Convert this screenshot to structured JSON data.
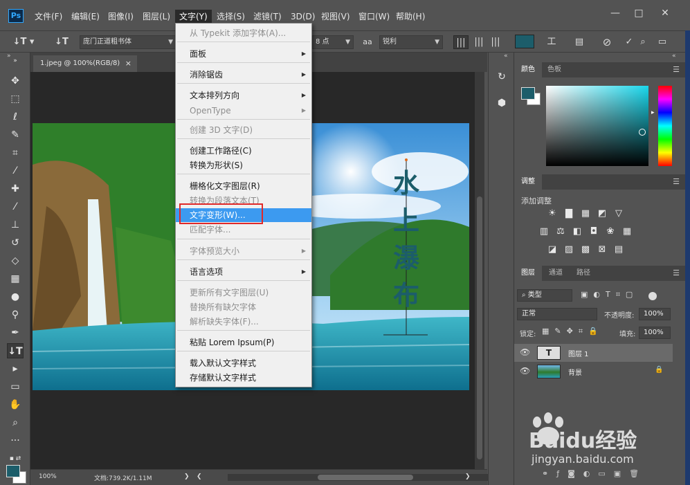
{
  "menubar": {
    "items": [
      "文件(F)",
      "编辑(E)",
      "图像(I)",
      "图层(L)",
      "文字(Y)",
      "选择(S)",
      "滤镜(T)",
      "3D(D)",
      "视图(V)",
      "窗口(W)",
      "帮助(H)"
    ],
    "active_index": 4,
    "window_buttons": [
      "—",
      "□",
      "✕"
    ]
  },
  "options_bar": {
    "font_family": "庞门正道粗书体",
    "font_size": "8 点",
    "antialias_label": "aa",
    "antialias_value": "锐利",
    "text_color": "#1c5d6a"
  },
  "document": {
    "tab_title": "1.jpeg @ 100%(RGB/8)",
    "tab_close": "×",
    "vertical_text": [
      "水",
      "上",
      "瀑",
      "布"
    ],
    "zoom": "100%",
    "doc_info": "文档:739.2K/1.11M"
  },
  "text_menu": {
    "items": [
      {
        "label": "从 Typekit 添加字体(A)...",
        "disabled": true,
        "submenu": false
      },
      {
        "label": "面板",
        "disabled": false,
        "submenu": true
      },
      {
        "label": "消除锯齿",
        "disabled": false,
        "submenu": true
      },
      {
        "label": "文本排列方向",
        "disabled": false,
        "submenu": true
      },
      {
        "label": "OpenType",
        "disabled": true,
        "submenu": true
      },
      {
        "label": "创建 3D 文字(D)",
        "disabled": true,
        "submenu": false
      },
      {
        "label": "创建工作路径(C)",
        "disabled": false,
        "submenu": false
      },
      {
        "label": "转换为形状(S)",
        "disabled": false,
        "submenu": false
      },
      {
        "label": "栅格化文字图层(R)",
        "disabled": false,
        "submenu": false
      },
      {
        "label": "转换为段落文本(T)",
        "disabled": true,
        "submenu": false
      },
      {
        "label": "文字变形(W)...",
        "disabled": false,
        "submenu": false,
        "highlighted": true
      },
      {
        "label": "匹配字体...",
        "disabled": true,
        "submenu": false
      },
      {
        "label": "字体预览大小",
        "disabled": true,
        "submenu": true
      },
      {
        "label": "语言选项",
        "disabled": false,
        "submenu": true
      },
      {
        "label": "更新所有文字图层(U)",
        "disabled": true,
        "submenu": false
      },
      {
        "label": "替换所有缺欠字体",
        "disabled": true,
        "submenu": false
      },
      {
        "label": "解析缺失字体(F)...",
        "disabled": true,
        "submenu": false
      },
      {
        "label": "粘贴 Lorem Ipsum(P)",
        "disabled": false,
        "submenu": false
      },
      {
        "label": "载入默认文字样式",
        "disabled": false,
        "submenu": false
      },
      {
        "label": "存储默认文字样式",
        "disabled": false,
        "submenu": false
      }
    ]
  },
  "panels": {
    "color_tabs": [
      "颜色",
      "色板"
    ],
    "adjust_tab": "调整",
    "adjust_label": "添加调整",
    "layers_tabs": [
      "图层",
      "通道",
      "路径"
    ],
    "filter_kind": "类型",
    "blend_mode": "正常",
    "opacity_label": "不透明度:",
    "opacity_value": "100%",
    "lock_label": "锁定:",
    "fill_label": "填充:",
    "fill_value": "100%",
    "layers": [
      {
        "name": "图层 1",
        "type": "text",
        "thumb_glyph": "T"
      },
      {
        "name": "背景",
        "type": "image",
        "lock": "🔒"
      }
    ],
    "foreground_color": "#1c5d6a",
    "background_color": "#ffffff"
  },
  "watermark": {
    "brand": "Baidu经验",
    "url": "jingyan.baidu.com"
  }
}
